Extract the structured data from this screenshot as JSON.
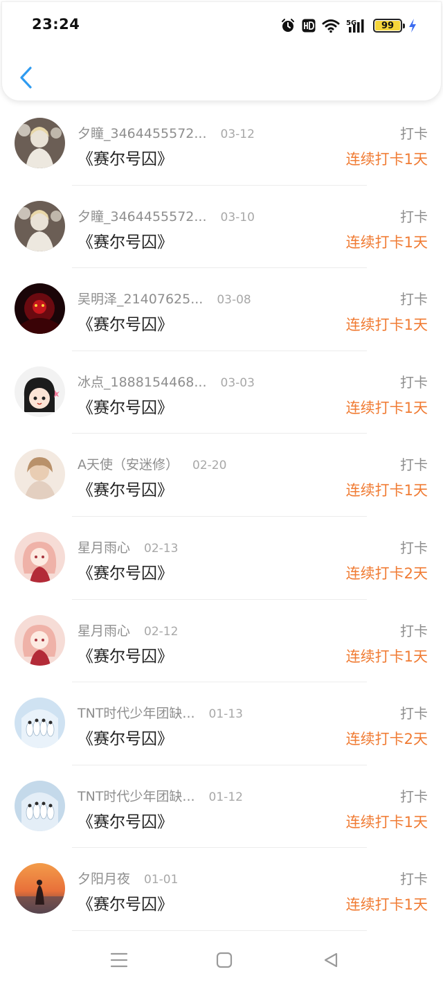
{
  "status_bar": {
    "time": "23:24",
    "battery_level": "99",
    "battery_fraction": 0.99,
    "network_label": "5G",
    "icons": [
      "alarm-icon",
      "hd-icon",
      "wifi-icon",
      "signal-icon",
      "battery-icon",
      "charging-icon"
    ]
  },
  "header": {
    "back_icon": "chevron-left-icon"
  },
  "colors": {
    "accent_blue": "#2f9bf0",
    "streak_orange": "#f07b33",
    "muted_gray": "#8e8e8e"
  },
  "list": {
    "items": [
      {
        "name": "夕瞳_3464455572...",
        "date": "03-12",
        "title": "《赛尔号囚》",
        "action": "打卡",
        "streak": "连续打卡1天"
      },
      {
        "name": "夕瞳_3464455572...",
        "date": "03-10",
        "title": "《赛尔号囚》",
        "action": "打卡",
        "streak": "连续打卡1天"
      },
      {
        "name": "吴明泽_21407625...",
        "date": "03-08",
        "title": "《赛尔号囚》",
        "action": "打卡",
        "streak": "连续打卡1天"
      },
      {
        "name": "冰点_1888154468...",
        "date": "03-03",
        "title": "《赛尔号囚》",
        "action": "打卡",
        "streak": "连续打卡1天"
      },
      {
        "name": "A天使（安迷修）",
        "date": "02-20",
        "title": "《赛尔号囚》",
        "action": "打卡",
        "streak": "连续打卡1天"
      },
      {
        "name": "星月雨心",
        "date": "02-13",
        "title": "《赛尔号囚》",
        "action": "打卡",
        "streak": "连续打卡2天"
      },
      {
        "name": "星月雨心",
        "date": "02-12",
        "title": "《赛尔号囚》",
        "action": "打卡",
        "streak": "连续打卡1天"
      },
      {
        "name": "TNT时代少年团缺...",
        "date": "01-13",
        "title": "《赛尔号囚》",
        "action": "打卡",
        "streak": "连续打卡2天"
      },
      {
        "name": "TNT时代少年团缺...",
        "date": "01-12",
        "title": "《赛尔号囚》",
        "action": "打卡",
        "streak": "连续打卡1天"
      },
      {
        "name": "夕阳月夜",
        "date": "01-01",
        "title": "《赛尔号囚》",
        "action": "打卡",
        "streak": "连续打卡1天"
      }
    ]
  },
  "nav_bar": {
    "icons": [
      "menu-icon",
      "home-square-icon",
      "back-triangle-icon"
    ]
  }
}
